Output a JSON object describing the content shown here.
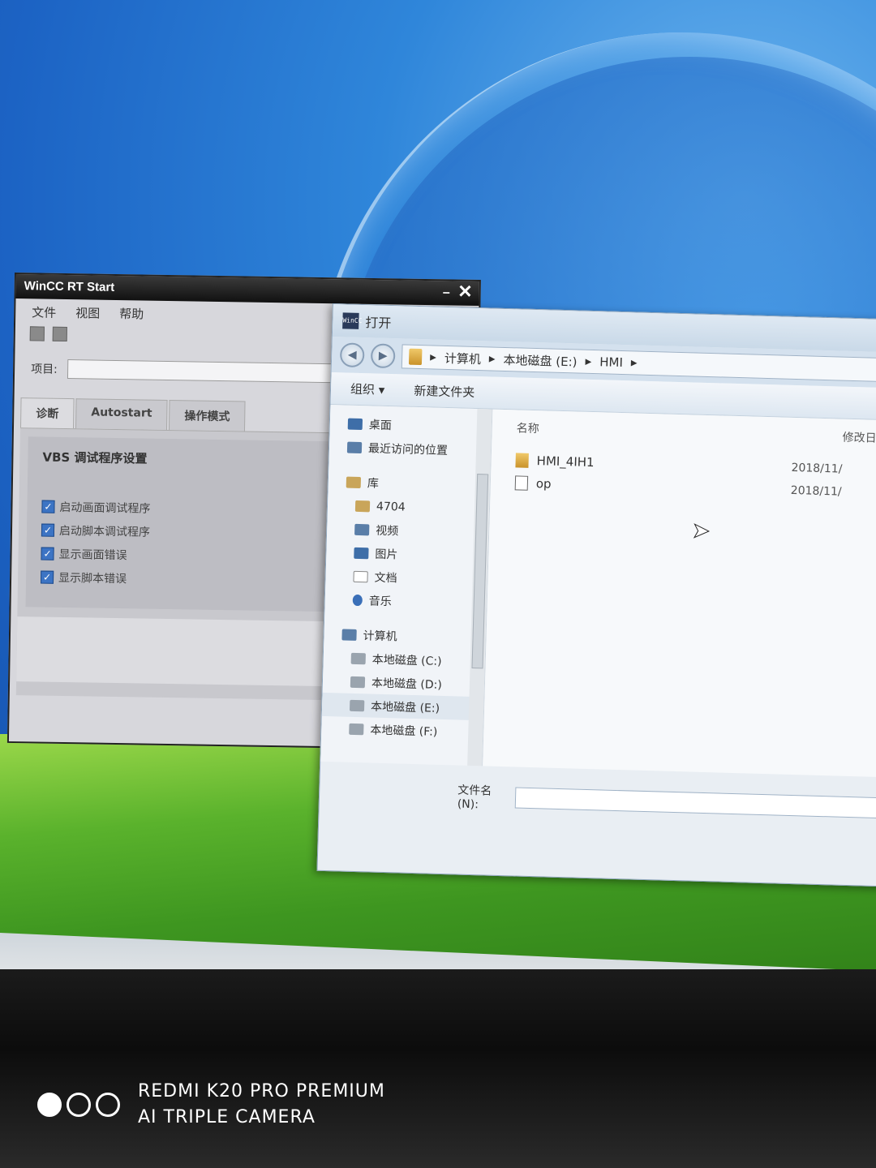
{
  "wincc": {
    "title": "WinCC RT Start",
    "close_glyph": "✕",
    "menu": [
      "文件",
      "视图",
      "帮助"
    ],
    "project_label": "项目:",
    "project_value": "",
    "tabs": [
      "诊断",
      "Autostart",
      "操作模式"
    ],
    "group_title": "VBS 调试程序设置",
    "options": [
      {
        "label": "启动画面调试程序",
        "checked": true
      },
      {
        "label": "启动脚本调试程序",
        "checked": true
      },
      {
        "label": "显示画面错误",
        "checked": true
      },
      {
        "label": "显示脚本错误",
        "checked": true
      }
    ]
  },
  "dialog": {
    "title": "打开",
    "app_icon_text": "WinCC",
    "breadcrumb": [
      "计算机",
      "本地磁盘 (E:)",
      "HMI"
    ],
    "commands": {
      "organize": "组织 ▾",
      "new_folder": "新建文件夹"
    },
    "nav": [
      {
        "label": "桌面",
        "icon": "desktop-icon",
        "level": 1
      },
      {
        "label": "最近访问的位置",
        "icon": "recent-icon",
        "level": 1
      },
      {
        "label": "库",
        "icon": "library-icon",
        "level": 0
      },
      {
        "label": "4704",
        "icon": "library-icon",
        "level": 2
      },
      {
        "label": "视频",
        "icon": "video-icon",
        "level": 2
      },
      {
        "label": "图片",
        "icon": "picture-icon",
        "level": 2
      },
      {
        "label": "文档",
        "icon": "document-icon",
        "level": 2
      },
      {
        "label": "音乐",
        "icon": "music-icon",
        "level": 2
      },
      {
        "label": "计算机",
        "icon": "computer-icon",
        "level": 0
      },
      {
        "label": "本地磁盘 (C:)",
        "icon": "drive-icon",
        "level": 2
      },
      {
        "label": "本地磁盘 (D:)",
        "icon": "drive-icon",
        "level": 2
      },
      {
        "label": "本地磁盘 (E:)",
        "icon": "drive-icon",
        "level": 2,
        "selected": true
      },
      {
        "label": "本地磁盘 (F:)",
        "icon": "drive-icon",
        "level": 2
      }
    ],
    "columns": {
      "name": "名称",
      "modified": "修改日期"
    },
    "files": [
      {
        "name": "HMI_4IH1",
        "type": "folder",
        "date": "2018/11/"
      },
      {
        "name": "op",
        "type": "file",
        "date": "2018/11/"
      }
    ],
    "filename_label": "文件名(N):",
    "filename_value": ""
  },
  "watermark": {
    "line1": "REDMI K20 PRO PREMIUM",
    "line2": "AI TRIPLE CAMERA"
  }
}
